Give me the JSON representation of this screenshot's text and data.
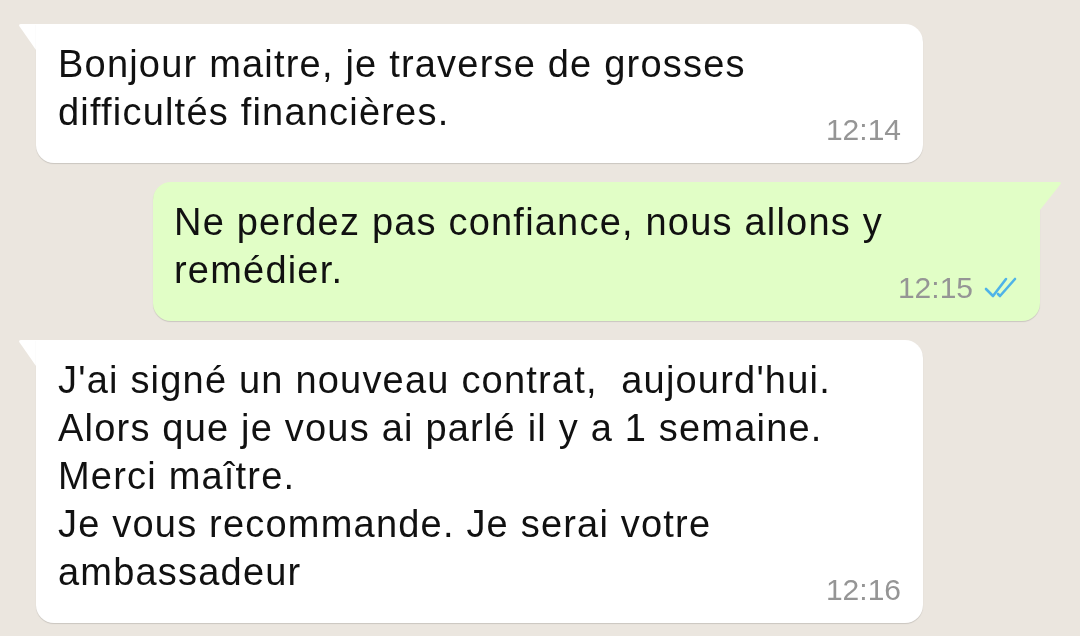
{
  "messages": [
    {
      "kind": "incoming",
      "text": "Bonjour maitre, je traverse de grosses difficultés financières.",
      "time": "12:14"
    },
    {
      "kind": "outgoing",
      "text": "Ne perdez pas confiance, nous allons y remédier.",
      "time": "12:15",
      "read": true
    },
    {
      "kind": "incoming",
      "text": "J'ai signé un nouveau contrat,  aujourd'hui.\nAlors que je vous ai parlé il y a 1 semaine.\nMerci maître.\nJe vous recommande. Je serai votre ambassadeur",
      "time": "12:16"
    }
  ]
}
